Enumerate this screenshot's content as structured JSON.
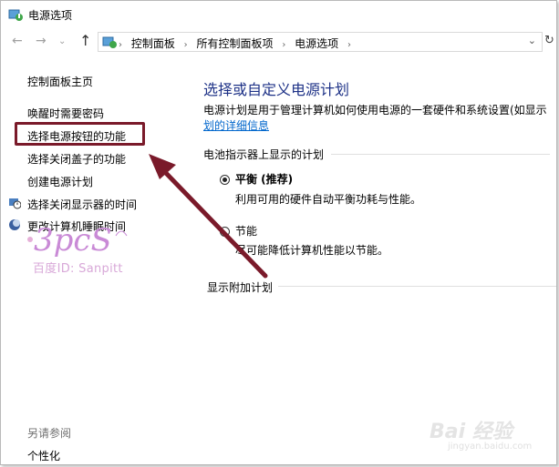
{
  "window": {
    "title": "电源选项"
  },
  "nav": {
    "back_icon": "arrow-left-icon",
    "forward_icon": "arrow-right-icon",
    "recent_icon": "chevron-down-icon",
    "up_icon": "arrow-up-icon",
    "breadcrumb": [
      "控制面板",
      "所有控制面板项",
      "电源选项"
    ],
    "refresh_icon": "refresh-icon"
  },
  "sidebar": {
    "home": "控制面板主页",
    "items": [
      {
        "label": "唤醒时需要密码"
      },
      {
        "label": "选择电源按钮的功能"
      },
      {
        "label": "选择关闭盖子的功能"
      },
      {
        "label": "创建电源计划"
      },
      {
        "label": "选择关闭显示器的时间"
      },
      {
        "label": "更改计算机睡眠时间"
      }
    ],
    "see_also": "另请参阅",
    "personalize": "个性化"
  },
  "watermark": {
    "text": "百度ID: Sanpitt",
    "logo_text": "3pcS",
    "baidu_text": "Bai 经验",
    "baidu_url": "jingyan.baidu.com"
  },
  "main": {
    "heading": "选择或自定义电源计划",
    "description": "电源计划是用于管理计算机如何使用电源的一套硬件和系统设置(如显示",
    "description_link": "划的详细信息",
    "section_label": "电池指示器上显示的计划",
    "plans": [
      {
        "name": "平衡 (推荐)",
        "desc": "利用可用的硬件自动平衡功耗与性能。",
        "checked": true
      },
      {
        "name": "节能",
        "desc": "尽可能降低计算机性能以节能。",
        "checked": false
      }
    ],
    "extra_plans": "显示附加计划"
  },
  "colors": {
    "heading": "#1e3287",
    "link": "#0066cc",
    "highlight": "#7a1a2a"
  }
}
